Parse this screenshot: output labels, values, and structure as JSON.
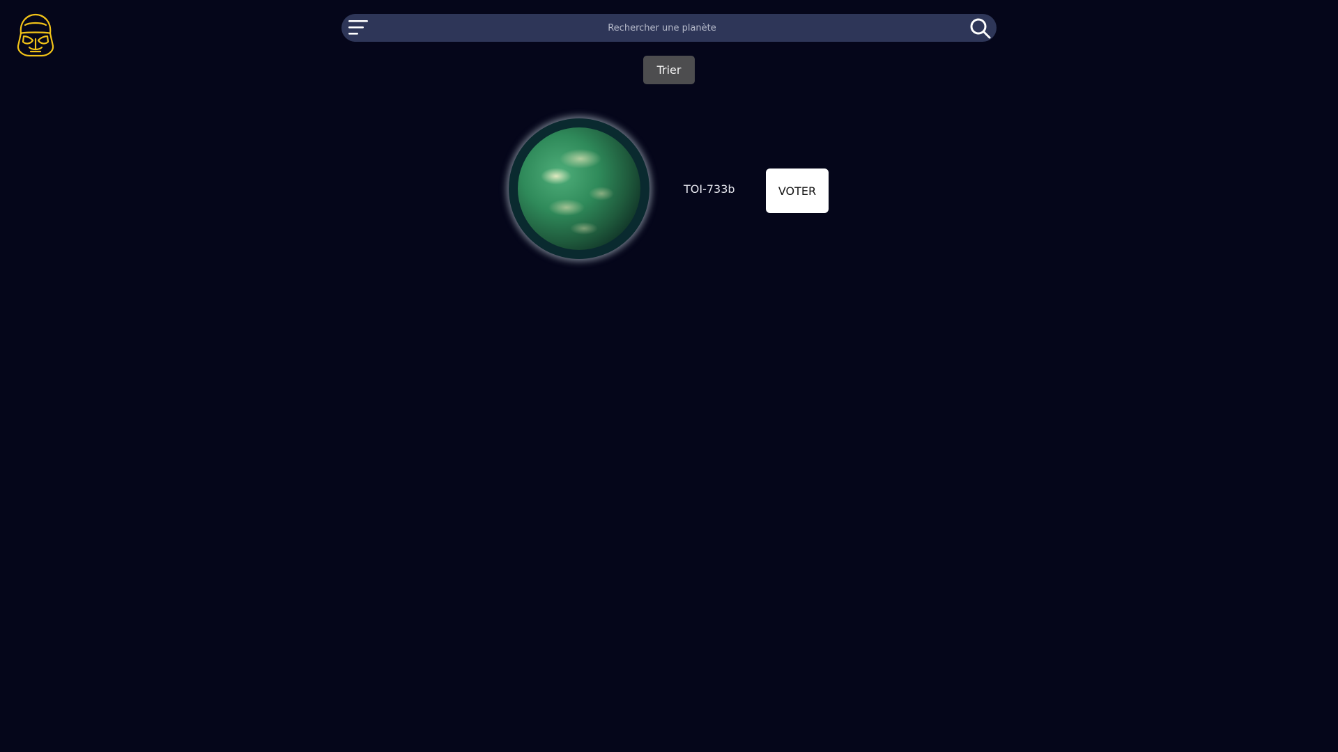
{
  "header": {
    "logo_icon": "stormtrooper-helmet-icon",
    "menu_icon": "hamburger-menu-icon",
    "search": {
      "placeholder": "Rechercher une planète",
      "value": "",
      "icon": "search-icon"
    }
  },
  "toolbar": {
    "sort_label": "Trier"
  },
  "planets": [
    {
      "name": "TOI-733b",
      "vote_label": "VOTER"
    }
  ],
  "colors": {
    "background": "#05061a",
    "searchbar": "#2e3658",
    "logo": "#f2c318",
    "sort_button": "#4d4d4f",
    "vote_button": "#ffffff"
  }
}
